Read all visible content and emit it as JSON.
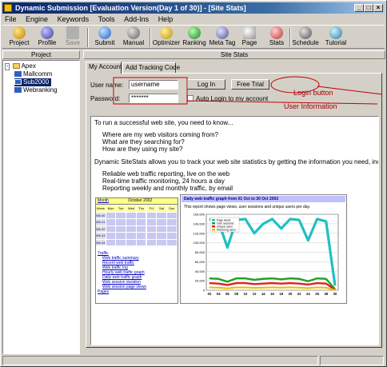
{
  "window": {
    "title": "Dynamic Submission [Evaluation Version(Day 1 of 30)] - [Site Stats]",
    "controls": [
      "_",
      "□",
      "×"
    ]
  },
  "menu": [
    "File",
    "Engine",
    "Keywords",
    "Tools",
    "Add-Ins",
    "Help"
  ],
  "toolbar": {
    "project": "Project",
    "profile": "Profile",
    "save": "Save",
    "submit": "Submit",
    "manual": "Manual",
    "optimizer": "Optimizer",
    "ranking": "Ranking",
    "metatag": "Meta Tag",
    "page": "Page",
    "stats": "Stats",
    "schedule": "Schedule",
    "tutorial": "Tutorial"
  },
  "left_panel": {
    "header": "Project",
    "tree": {
      "root": "Apex",
      "children": [
        "Mallcomm",
        "Sub2000",
        "Webranking"
      ],
      "selected": "Sub2000"
    }
  },
  "right_panel": {
    "header": "Site Stats",
    "tabs": [
      "My Account",
      "Add Tracking Code"
    ],
    "active_tab": "My Account"
  },
  "account": {
    "username_label": "User name:",
    "username_value": "username",
    "password_label": "Password:",
    "password_value": "*******",
    "login_button": "Log In",
    "trial_button": "Free Trial",
    "auto_login_label": "Auto Login to my account"
  },
  "annotations": {
    "login": "Login button",
    "user_info": "User Information"
  },
  "info": {
    "intro": "To run a successful web site, you need to know...",
    "questions": [
      "Where are my web visitors coming from?",
      "What are they searching for?",
      "How are they using my site?"
    ],
    "pitch": "Dynamic SiteStats allows you to track your web site statistics by getting the information you need, including:",
    "features": [
      "Reliable web traffic reporting, live on the web",
      "Real-time traffic monitoring, 24 hours a day",
      "Reporting weekly and monthly traffic, by email"
    ]
  },
  "calendar": {
    "month_label": "Month",
    "month_title": "October 2002",
    "days": [
      "Week",
      "Mon",
      "Tue",
      "Wed",
      "Thu",
      "Fri",
      "Sat",
      "Sun"
    ],
    "week_labels": [
      "Wk 40",
      "Wk 41",
      "Wk 42",
      "Wk 43",
      "Wk 44"
    ]
  },
  "traffic_menu": {
    "header": "Traffic",
    "items": [
      "Web traffic summary",
      "Recent web traffic",
      "Web traffic log",
      "Hourly web traffic graph",
      "Daily web traffic graph",
      "Web session duration",
      "Web session page views"
    ],
    "footer": "Pages"
  },
  "chart_data": {
    "type": "line",
    "title": "Daily web traffic graph from 01 Oct to 30 Oct 2002",
    "subtitle": "This report shows page views, user sessions and unique users per day.",
    "categories": [
      "02",
      "04",
      "06",
      "08",
      "10",
      "12",
      "14",
      "16",
      "18",
      "20",
      "22",
      "24",
      "26",
      "28",
      "30"
    ],
    "y_ticks": [
      "160,000",
      "140,000",
      "120,000",
      "100,000",
      "80,000",
      "60,000",
      "40,000",
      "20,000",
      "0"
    ],
    "ylim": [
      0,
      160000
    ],
    "legend": [
      "Page views",
      "User sessions",
      "Unique users",
      "Returning users"
    ],
    "legend_placement": "top-left",
    "colors": {
      "page_views": "#20c0c0",
      "user_sessions": "#20a020",
      "unique_users": "#e02020",
      "returning_users": "#e0c000"
    },
    "series": [
      {
        "name": "Page views",
        "values": [
          150000,
          145000,
          90000,
          148000,
          150000,
          120000,
          140000,
          150000,
          130000,
          150000,
          148000,
          105000,
          150000,
          145000,
          10000
        ]
      },
      {
        "name": "User sessions",
        "values": [
          25000,
          24000,
          18000,
          25000,
          25000,
          22000,
          24000,
          25000,
          23000,
          25000,
          24000,
          19000,
          25000,
          24000,
          2000
        ]
      },
      {
        "name": "Unique users",
        "values": [
          15000,
          14000,
          11000,
          15000,
          15000,
          13000,
          14000,
          15000,
          14000,
          15000,
          14000,
          12000,
          15000,
          14000,
          1000
        ]
      },
      {
        "name": "Returning users",
        "values": [
          6000,
          5500,
          4000,
          6000,
          6000,
          5000,
          5500,
          6000,
          5500,
          6000,
          5500,
          4500,
          6000,
          5500,
          500
        ]
      }
    ]
  }
}
